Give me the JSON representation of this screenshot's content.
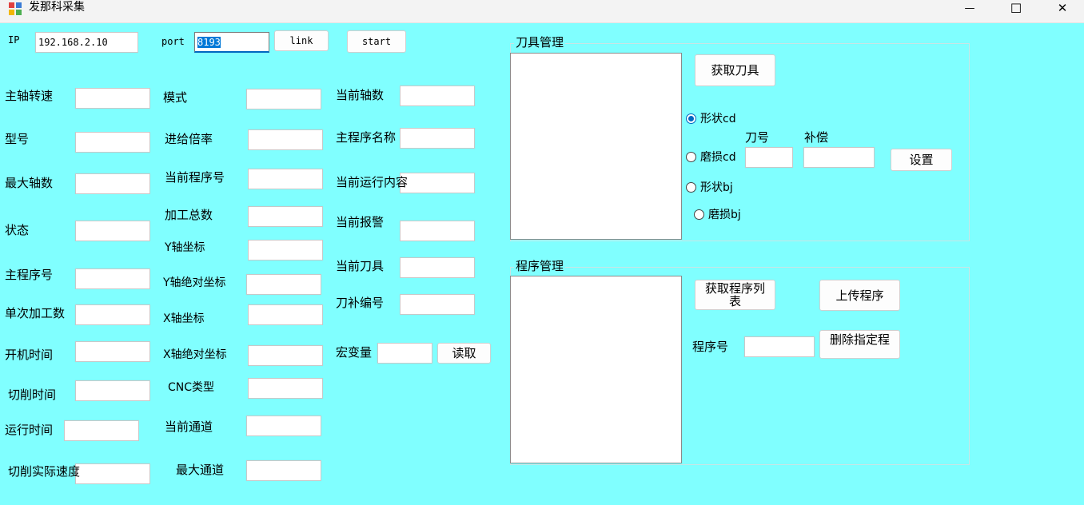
{
  "window": {
    "title": "发那科采集",
    "minimize_glyph": "—",
    "maximize_glyph": "☐",
    "close_glyph": "✕"
  },
  "connection": {
    "ip_label": "IP",
    "ip_value": "192.168.2.10",
    "port_label": "port",
    "port_value": "8193",
    "link_label": "link",
    "start_label": "start"
  },
  "col1": {
    "spindle_speed": "主轴转速",
    "model": "型号",
    "max_axes": "最大轴数",
    "status": "状态",
    "main_program_no": "主程序号",
    "single_count": "单次加工数",
    "power_on_time": "开机时间",
    "cutting_time": "切削时间",
    "run_time": "运行时间",
    "actual_cut_speed": "切削实际速度"
  },
  "col2": {
    "mode": "模式",
    "feed_override": "进给倍率",
    "current_program_no": "当前程序号",
    "total_parts": "加工总数",
    "y_coord": "Y轴坐标",
    "y_abs_coord": "Y轴绝对坐标",
    "x_coord": "X轴坐标",
    "x_abs_coord": "X轴绝对坐标",
    "cnc_type": "CNC类型",
    "current_channel": "当前通道",
    "max_channel": "最大通道"
  },
  "col3": {
    "current_axes": "当前轴数",
    "main_program_name": "主程序名称",
    "current_run_content": "当前运行内容",
    "current_alarm": "当前报警",
    "current_tool": "当前刀具",
    "tool_offset_no": "刀补编号",
    "macro_var": "宏变量",
    "read_label": "读取"
  },
  "tool_mgmt": {
    "title": "刀具管理",
    "get_tools": "获取刀具",
    "radio_shape_cd": "形状cd",
    "radio_wear_cd": "磨损cd",
    "radio_shape_bj": "形状bj",
    "radio_wear_bj": "磨损bj",
    "tool_no_label": "刀号",
    "offset_label": "补偿",
    "set_label": "设置",
    "selected_radio": "形状cd"
  },
  "program_mgmt": {
    "title": "程序管理",
    "get_program_list": "获取程序列表",
    "upload_program": "上传程序",
    "program_no_label": "程序号",
    "delete_program": "删除指定程"
  },
  "colors": {
    "background": "#80ffff",
    "accent": "#0067c0"
  }
}
